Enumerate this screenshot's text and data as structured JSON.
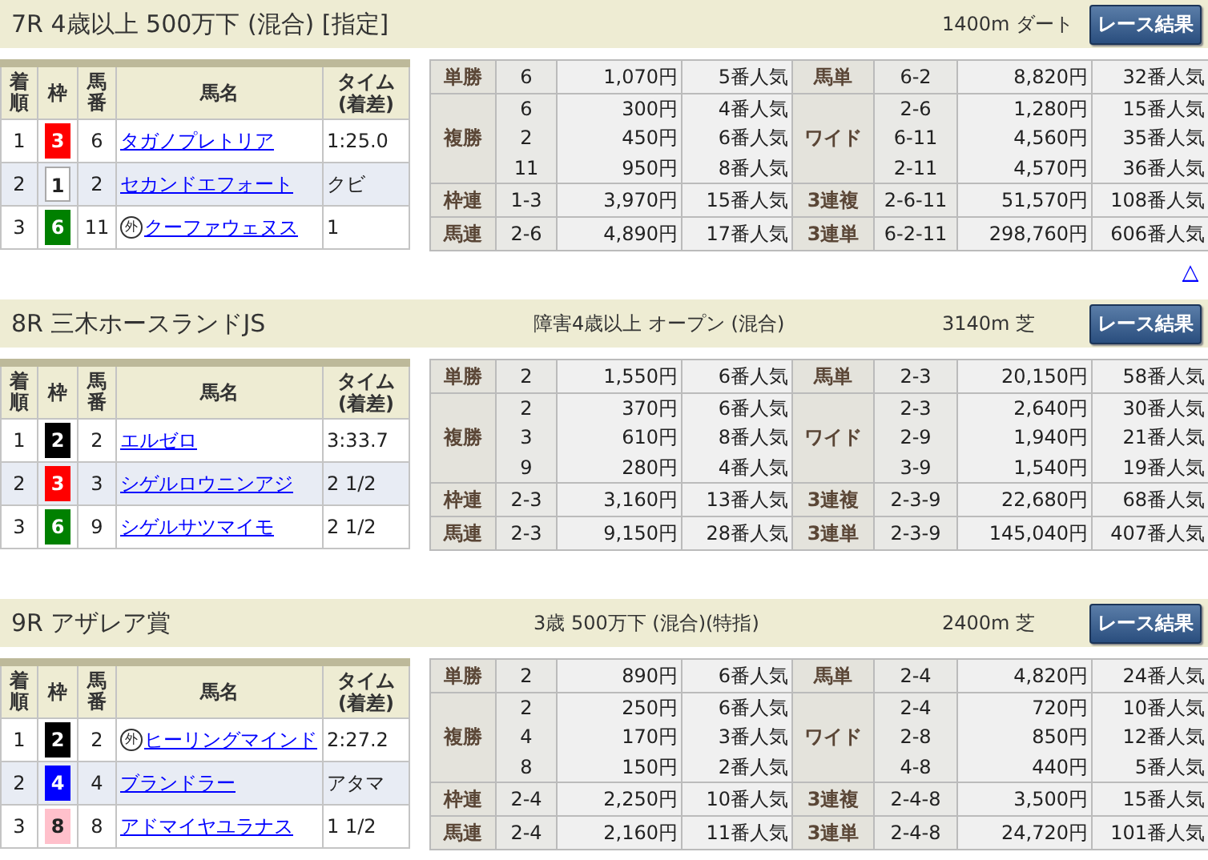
{
  "races": [
    {
      "header": {
        "title": "7R 4歳以上 500万下 (混合) [指定]",
        "course": "1400m ダート",
        "button": "レース結果"
      },
      "result_columns": [
        "着順",
        "枠",
        "馬番",
        "馬名",
        "タイム\n(着差)"
      ],
      "results": [
        {
          "place": "1",
          "frame": "3",
          "color": "#ff0000",
          "number": "6",
          "name": "タガノプレトリア",
          "time": "1:25.0"
        },
        {
          "place": "2",
          "frame": "1",
          "color": "#ffffff",
          "number": "2",
          "name": "セカンドエフォート",
          "time": "クビ"
        },
        {
          "place": "3",
          "frame": "6",
          "color": "#008000",
          "number": "11",
          "mark": "外",
          "name": "クーファウェヌス",
          "time": "1"
        }
      ],
      "payouts": [
        {
          "left": {
            "bet": "単勝",
            "entries": [
              [
                "6",
                "1,070円",
                "5番人気"
              ]
            ]
          },
          "right": {
            "bet": "馬単",
            "entries": [
              [
                "6-2",
                "8,820円",
                "32番人気"
              ]
            ]
          }
        },
        {
          "left": {
            "bet": "複勝",
            "entries": [
              [
                "6",
                "300円",
                "4番人気"
              ],
              [
                "2",
                "450円",
                "6番人気"
              ],
              [
                "11",
                "950円",
                "8番人気"
              ]
            ]
          },
          "right": {
            "bet": "ワイド",
            "entries": [
              [
                "2-6",
                "1,280円",
                "15番人気"
              ],
              [
                "6-11",
                "4,560円",
                "35番人気"
              ],
              [
                "2-11",
                "4,570円",
                "36番人気"
              ]
            ]
          }
        },
        {
          "left": {
            "bet": "枠連",
            "entries": [
              [
                "1-3",
                "3,970円",
                "15番人気"
              ]
            ]
          },
          "right": {
            "bet": "3連複",
            "entries": [
              [
                "2-6-11",
                "51,570円",
                "108番人気"
              ]
            ]
          }
        },
        {
          "left": {
            "bet": "馬連",
            "entries": [
              [
                "2-6",
                "4,890円",
                "17番人気"
              ]
            ]
          },
          "right": {
            "bet": "3連単",
            "entries": [
              [
                "6-2-11",
                "298,760円",
                "606番人気"
              ]
            ]
          }
        }
      ],
      "top_link": "△"
    },
    {
      "header": {
        "title": "8R 三木ホースランドJS",
        "condition": "障害4歳以上 オープン (混合)",
        "course": "3140m 芝",
        "button": "レース結果"
      },
      "result_columns": [
        "着順",
        "枠",
        "馬番",
        "馬名",
        "タイム\n(着差)"
      ],
      "results": [
        {
          "place": "1",
          "frame": "2",
          "color": "#000000",
          "number": "2",
          "name": "エルゼロ",
          "time": "3:33.7"
        },
        {
          "place": "2",
          "frame": "3",
          "color": "#ff0000",
          "number": "3",
          "name": "シゲルロウニンアジ",
          "time": "2 1/2"
        },
        {
          "place": "3",
          "frame": "6",
          "color": "#008000",
          "number": "9",
          "name": "シゲルサツマイモ",
          "time": "2 1/2"
        }
      ],
      "payouts": [
        {
          "left": {
            "bet": "単勝",
            "entries": [
              [
                "2",
                "1,550円",
                "6番人気"
              ]
            ]
          },
          "right": {
            "bet": "馬単",
            "entries": [
              [
                "2-3",
                "20,150円",
                "58番人気"
              ]
            ]
          }
        },
        {
          "left": {
            "bet": "複勝",
            "entries": [
              [
                "2",
                "370円",
                "6番人気"
              ],
              [
                "3",
                "610円",
                "8番人気"
              ],
              [
                "9",
                "280円",
                "4番人気"
              ]
            ]
          },
          "right": {
            "bet": "ワイド",
            "entries": [
              [
                "2-3",
                "2,640円",
                "30番人気"
              ],
              [
                "2-9",
                "1,940円",
                "21番人気"
              ],
              [
                "3-9",
                "1,540円",
                "19番人気"
              ]
            ]
          }
        },
        {
          "left": {
            "bet": "枠連",
            "entries": [
              [
                "2-3",
                "3,160円",
                "13番人気"
              ]
            ]
          },
          "right": {
            "bet": "3連複",
            "entries": [
              [
                "2-3-9",
                "22,680円",
                "68番人気"
              ]
            ]
          }
        },
        {
          "left": {
            "bet": "馬連",
            "entries": [
              [
                "2-3",
                "9,150円",
                "28番人気"
              ]
            ]
          },
          "right": {
            "bet": "3連単",
            "entries": [
              [
                "2-3-9",
                "145,040円",
                "407番人気"
              ]
            ]
          }
        }
      ]
    },
    {
      "header": {
        "title": "9R アザレア賞",
        "condition": "3歳 500万下 (混合)(特指)",
        "course": "2400m 芝",
        "button": "レース結果"
      },
      "result_columns": [
        "着順",
        "枠",
        "馬番",
        "馬名",
        "タイム\n(着差)"
      ],
      "results": [
        {
          "place": "1",
          "frame": "2",
          "color": "#000000",
          "number": "2",
          "mark": "外",
          "name": "ヒーリングマインド",
          "time": "2:27.2"
        },
        {
          "place": "2",
          "frame": "4",
          "color": "#0000ff",
          "number": "4",
          "name": "ブランドラー",
          "time": "アタマ"
        },
        {
          "place": "3",
          "frame": "8",
          "color": "#ffc0cb",
          "number": "8",
          "name": "アドマイヤユラナス",
          "time": "1 1/2"
        }
      ],
      "payouts": [
        {
          "left": {
            "bet": "単勝",
            "entries": [
              [
                "2",
                "890円",
                "6番人気"
              ]
            ]
          },
          "right": {
            "bet": "馬単",
            "entries": [
              [
                "2-4",
                "4,820円",
                "24番人気"
              ]
            ]
          }
        },
        {
          "left": {
            "bet": "複勝",
            "entries": [
              [
                "2",
                "250円",
                "6番人気"
              ],
              [
                "4",
                "170円",
                "3番人気"
              ],
              [
                "8",
                "150円",
                "2番人気"
              ]
            ]
          },
          "right": {
            "bet": "ワイド",
            "entries": [
              [
                "2-4",
                "720円",
                "10番人気"
              ],
              [
                "2-8",
                "850円",
                "12番人気"
              ],
              [
                "4-8",
                "440円",
                "5番人気"
              ]
            ]
          }
        },
        {
          "left": {
            "bet": "枠連",
            "entries": [
              [
                "2-4",
                "2,250円",
                "10番人気"
              ]
            ]
          },
          "right": {
            "bet": "3連複",
            "entries": [
              [
                "2-4-8",
                "3,500円",
                "15番人気"
              ]
            ]
          }
        },
        {
          "left": {
            "bet": "馬連",
            "entries": [
              [
                "2-4",
                "2,160円",
                "11番人気"
              ]
            ]
          },
          "right": {
            "bet": "3連単",
            "entries": [
              [
                "2-4-8",
                "24,720円",
                "101番人気"
              ]
            ]
          }
        }
      ]
    }
  ]
}
